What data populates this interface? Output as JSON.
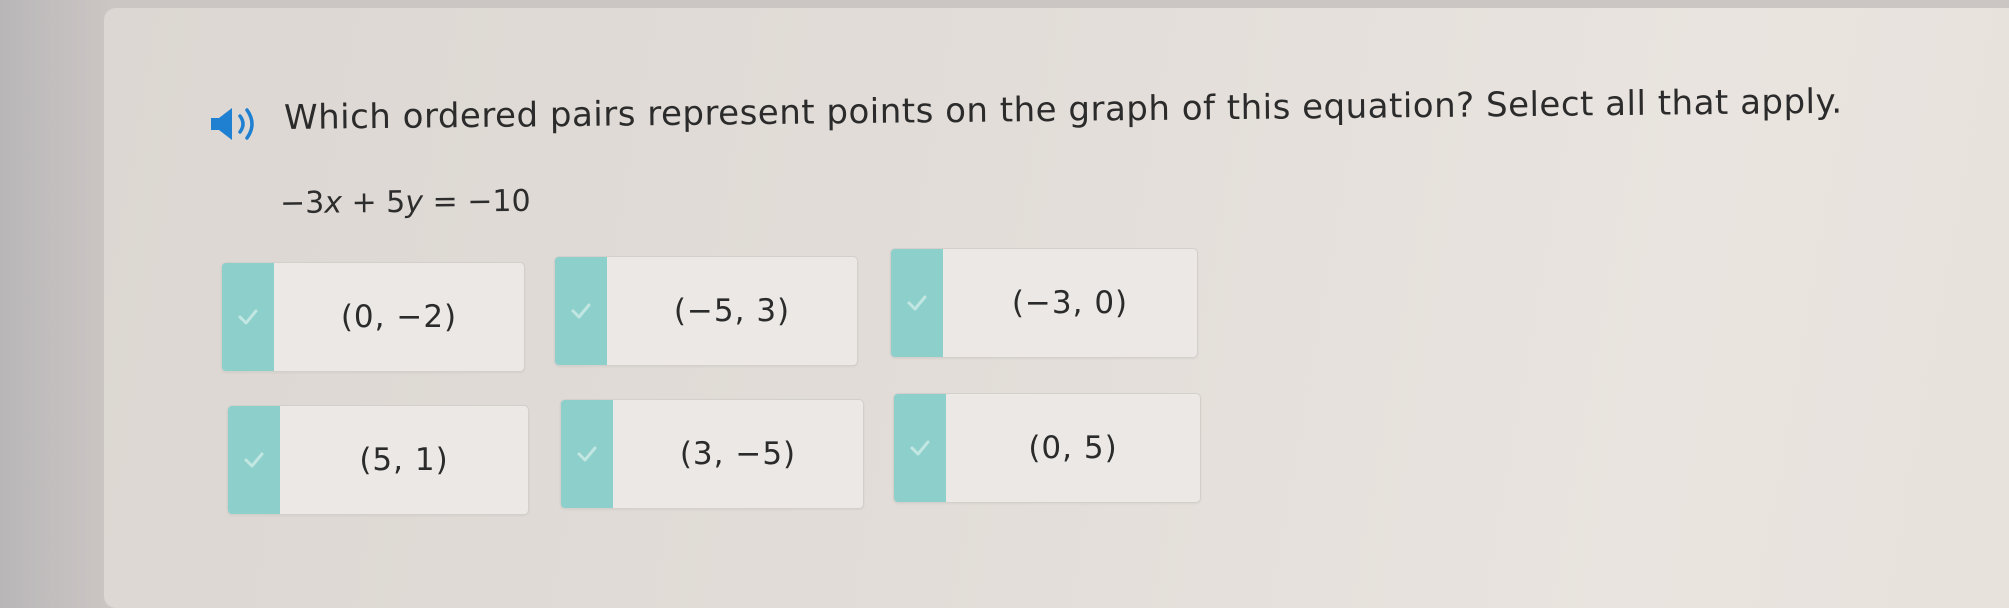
{
  "question": {
    "audio_icon": "speaker-icon",
    "text": "Which ordered pairs represent points on the graph of this equation? Select all that apply."
  },
  "equation": {
    "part1": "−3",
    "var1": "x",
    "part2": " + 5",
    "var2": "y",
    "part3": " = −10"
  },
  "options": [
    {
      "label": "(0, −2)",
      "icon": "check-icon"
    },
    {
      "label": "(−5, 3)",
      "icon": "check-icon"
    },
    {
      "label": "(−3, 0)",
      "icon": "check-icon"
    },
    {
      "label": "(5, 1)",
      "icon": "check-icon"
    },
    {
      "label": "(3, −5)",
      "icon": "check-icon"
    },
    {
      "label": "(0, 5)",
      "icon": "check-icon"
    }
  ],
  "colors": {
    "accent": "#1f7fd1",
    "check_strip": "#8ccfcb",
    "panel": "#e4dfda"
  }
}
